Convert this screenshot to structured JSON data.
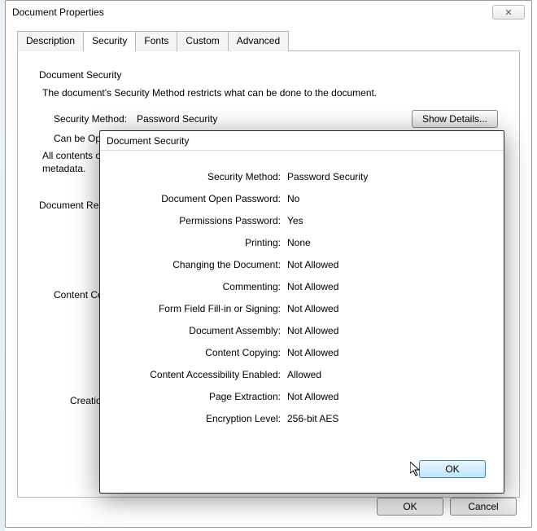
{
  "main": {
    "title": "Document Properties",
    "close": "✕",
    "tabs": [
      "Description",
      "Security",
      "Fonts",
      "Custom",
      "Advanced"
    ],
    "section_title": "Document Security",
    "intro": "The document's Security Method restricts what can be done to the document.",
    "sec_method_label": "Security Method:",
    "sec_method_value": "Password Security",
    "show_details": "Show Details...",
    "can_open": "Can be Open",
    "all_contents1": "All contents of",
    "all_contents2": "metadata.",
    "restrict_label": "Document Restr",
    "content_cop": "Content Cop",
    "creatio": "Creatio",
    "ok": "OK",
    "cancel": "Cancel"
  },
  "inner": {
    "title": "Document Security",
    "rows": [
      {
        "label": "Security Method:",
        "value": "Password Security"
      },
      {
        "label": "Document Open Password:",
        "value": "No"
      },
      {
        "label": "Permissions Password:",
        "value": "Yes"
      },
      {
        "label": "Printing:",
        "value": "None"
      },
      {
        "label": "Changing the Document:",
        "value": "Not Allowed"
      },
      {
        "label": "Commenting:",
        "value": "Not Allowed"
      },
      {
        "label": "Form Field Fill-in or Signing:",
        "value": "Not Allowed"
      },
      {
        "label": "Document Assembly:",
        "value": "Not Allowed"
      },
      {
        "label": "Content Copying:",
        "value": "Not Allowed"
      },
      {
        "label": "Content Accessibility Enabled:",
        "value": "Allowed"
      },
      {
        "label": "Page Extraction:",
        "value": "Not Allowed"
      },
      {
        "label": "Encryption Level:",
        "value": "256-bit AES"
      }
    ],
    "ok": "OK"
  }
}
